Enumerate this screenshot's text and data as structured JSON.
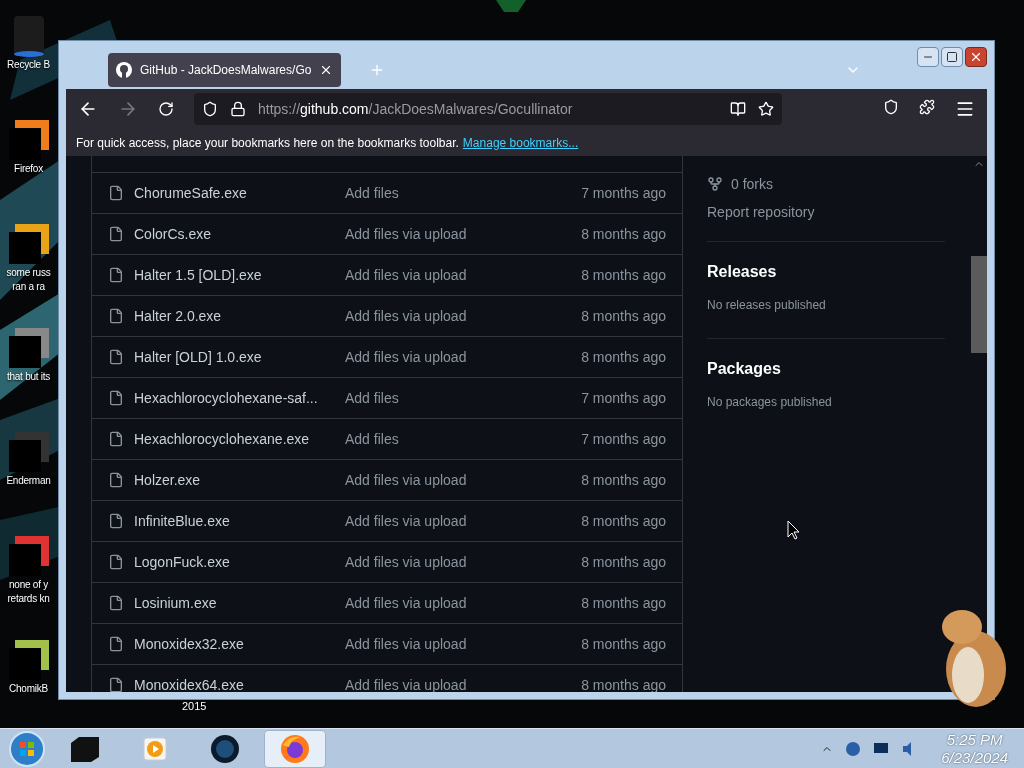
{
  "desktop": {
    "icons": [
      {
        "lines": [
          "Recycle B"
        ],
        "kind": "bin"
      },
      {
        "lines": [
          "Firefox"
        ],
        "kind": "app"
      },
      {
        "lines": [
          "some russ",
          "ran a ra"
        ],
        "kind": "app"
      },
      {
        "lines": [
          "that but its"
        ],
        "kind": "app"
      },
      {
        "lines": [
          "Enderman"
        ],
        "kind": "app"
      },
      {
        "lines": [
          "none of y",
          "retards kn"
        ],
        "kind": "app"
      },
      {
        "lines": [
          "ChomikB"
        ],
        "kind": "app"
      }
    ],
    "hidden_icon_label": "2015"
  },
  "browser": {
    "tab_title": "GitHub - JackDoesMalwares/Go",
    "url_scheme": "https://",
    "url_host": "github.com",
    "url_path": "/JackDoesMalwares/Gocullinator",
    "bookmarks_hint": "For quick access, place your bookmarks here on the bookmarks toolbar.",
    "bookmarks_link": "Manage bookmarks..."
  },
  "files": [
    {
      "name": "ChorumeSafe.exe",
      "message": "Add files",
      "age": "7 months ago"
    },
    {
      "name": "ColorCs.exe",
      "message": "Add files via upload",
      "age": "8 months ago"
    },
    {
      "name": "Halter 1.5 [OLD].exe",
      "message": "Add files via upload",
      "age": "8 months ago"
    },
    {
      "name": "Halter 2.0.exe",
      "message": "Add files via upload",
      "age": "8 months ago"
    },
    {
      "name": "Halter [OLD] 1.0.exe",
      "message": "Add files via upload",
      "age": "8 months ago"
    },
    {
      "name": "Hexachlorocyclohexane-saf...",
      "message": "Add files",
      "age": "7 months ago"
    },
    {
      "name": "Hexachlorocyclohexane.exe",
      "message": "Add files",
      "age": "7 months ago"
    },
    {
      "name": "Holzer.exe",
      "message": "Add files via upload",
      "age": "8 months ago"
    },
    {
      "name": "InfiniteBlue.exe",
      "message": "Add files via upload",
      "age": "8 months ago"
    },
    {
      "name": "LogonFuck.exe",
      "message": "Add files via upload",
      "age": "8 months ago"
    },
    {
      "name": "Losinium.exe",
      "message": "Add files via upload",
      "age": "8 months ago"
    },
    {
      "name": "Monoxidex32.exe",
      "message": "Add files via upload",
      "age": "8 months ago"
    },
    {
      "name": "Monoxidex64.exe",
      "message": "Add files via upload",
      "age": "8 months ago"
    }
  ],
  "sidebar": {
    "forks": "0 forks",
    "report": "Report repository",
    "sections": [
      {
        "title": "Releases",
        "text": "No releases published"
      },
      {
        "title": "Packages",
        "text": "No packages published"
      }
    ]
  },
  "taskbar": {
    "apps": [
      {
        "kind": "box",
        "selected": false
      },
      {
        "kind": "player",
        "selected": false
      },
      {
        "kind": "globe",
        "selected": false
      },
      {
        "kind": "firefox",
        "selected": true
      }
    ],
    "time": "5:25 PM",
    "date": "6/23/2024"
  }
}
